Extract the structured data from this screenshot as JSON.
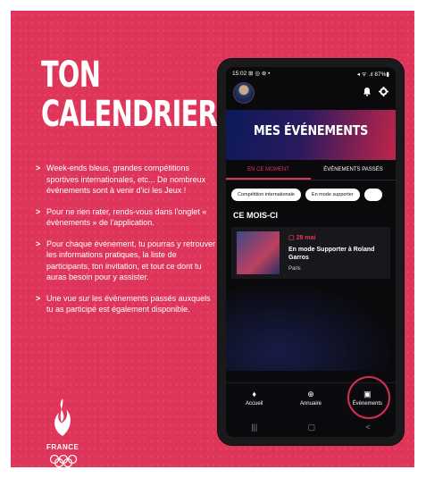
{
  "poster": {
    "title_line1": "TON",
    "title_line2": "CALENDRIER",
    "bullets": [
      "Week-ends bleus, grandes compétitions sportives internationales, etc... De nombreux événements sont à venir d'ici les Jeux !",
      "Pour ne rien rater, rends-vous dans l'onglet « évènements » de l'application.",
      "Pour chaque événement, tu pourras y retrouver les informations pratiques, la liste de participants, ton invitation, et tout ce dont tu auras besoin pour y assister.",
      "Une vue sur les évènements passés auxquels tu as participé est également disponible."
    ],
    "bullet_marker": ">",
    "logo_text": "FRANCE"
  },
  "phone": {
    "status": {
      "time": "15:02",
      "indicators": "⊞ ◎ ⊛ •",
      "right": "◂ ᯤ .ıl 87%▮"
    },
    "hero_title": "MES ÉVÉNEMENTS",
    "tabs": [
      {
        "label": "EN CE MOMENT",
        "active": true
      },
      {
        "label": "ÉVÉNEMENTS PASSÉS",
        "active": false
      }
    ],
    "chips": [
      "Compétition internationale",
      "En mode supporter",
      ""
    ],
    "section_title": "CE MOIS-CI",
    "event": {
      "date": "28 mai",
      "title": "En mode Supporter à Roland Garros",
      "location": "Paris"
    },
    "nav": [
      {
        "label": "Accueil",
        "icon": "flame-icon"
      },
      {
        "label": "Annuaire",
        "icon": "directory-icon"
      },
      {
        "label": "Évènements",
        "icon": "calendar-icon"
      }
    ],
    "system_nav": {
      "recent": "|||",
      "home": "▢",
      "back": "<"
    }
  },
  "colors": {
    "brand_red": "#e0355a",
    "screen_bg": "#0a0a0d",
    "hero_blue": "#0b1a5a"
  }
}
